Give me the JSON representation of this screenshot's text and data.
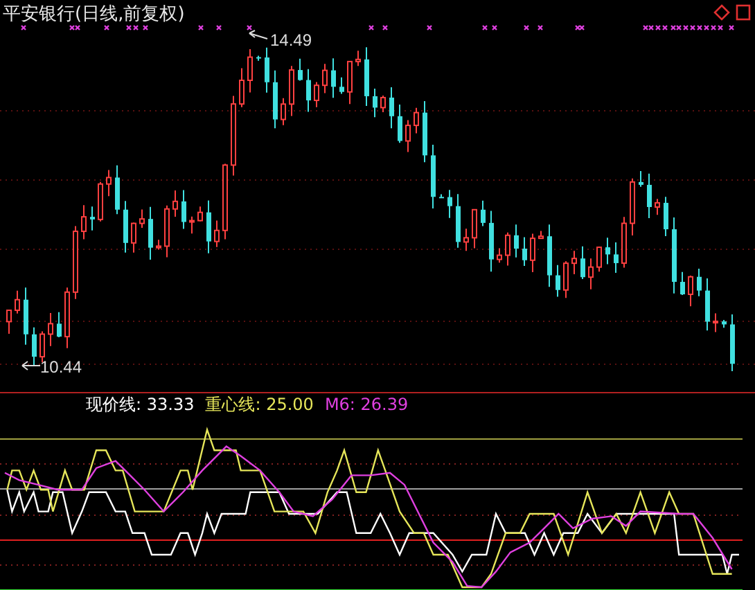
{
  "title": "平安银行(日线,前复权)",
  "main_chart": {
    "high_label": "14.49",
    "low_label": "10.44"
  },
  "indicator": {
    "legend": [
      {
        "text": "现价线: 33.33",
        "color": "#ffffff"
      },
      {
        "text": "重心线: 25.00",
        "color": "#e6e65a"
      },
      {
        "text": "M6: 26.39",
        "color": "#e040e0"
      }
    ]
  }
}
